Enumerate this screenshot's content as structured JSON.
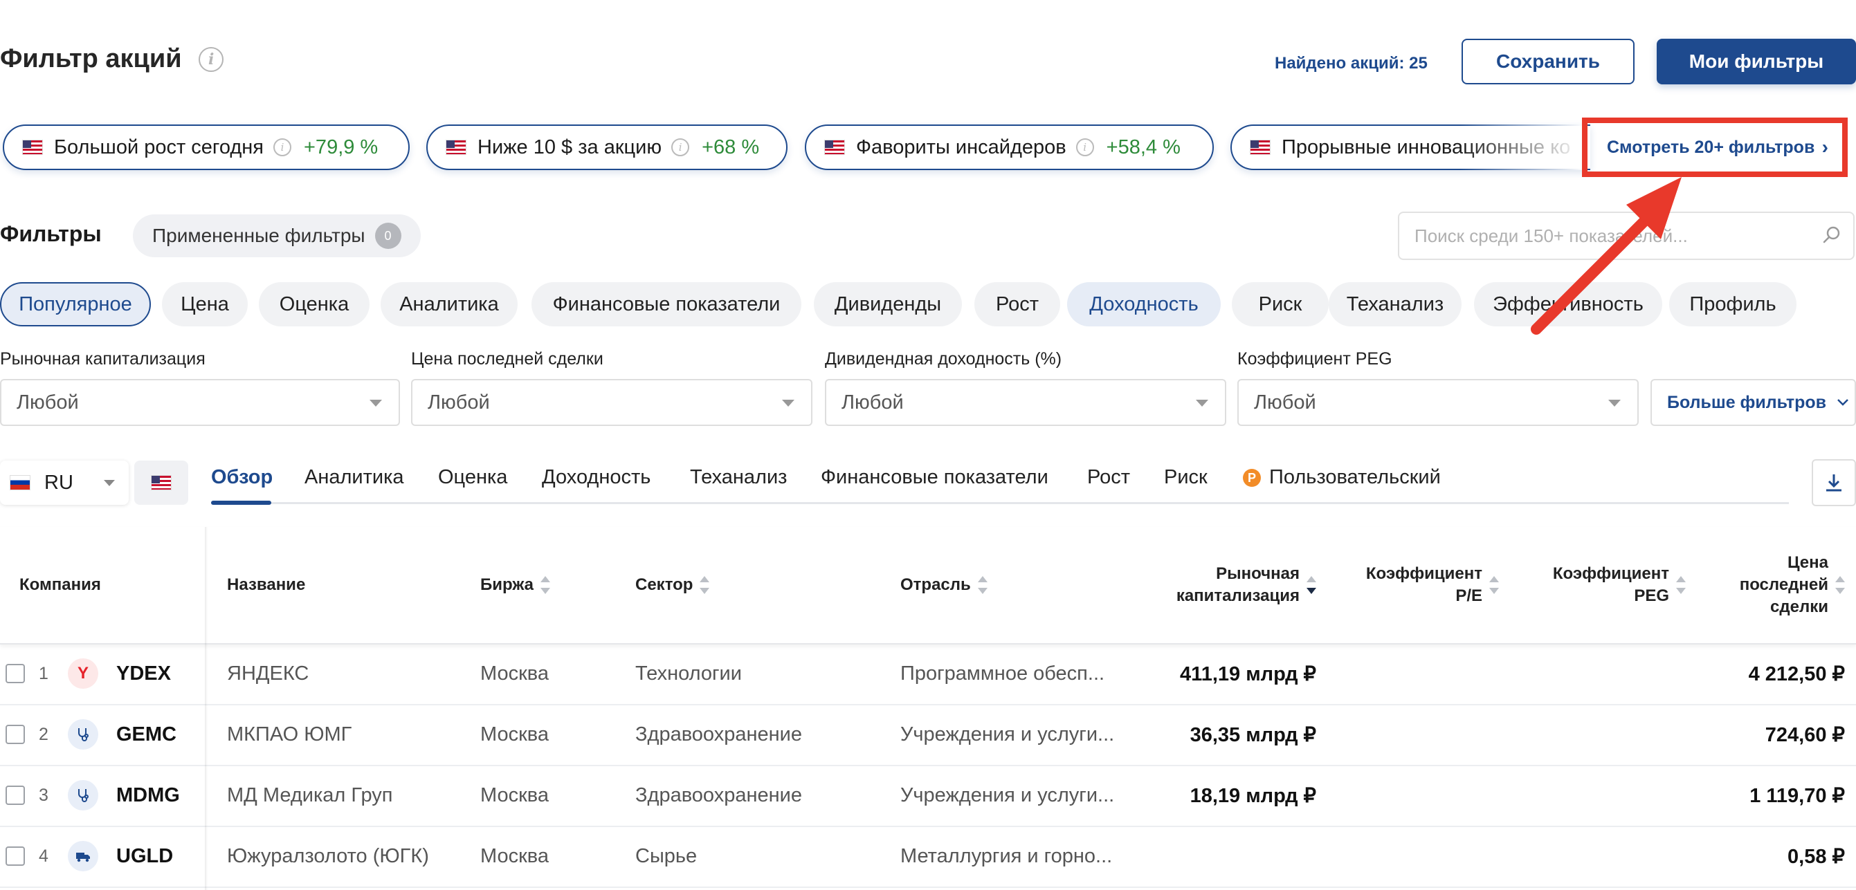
{
  "header": {
    "title": "Фильтр акций",
    "found_label": "Найдено акций: 25",
    "save_label": "Сохранить",
    "my_filters_label": "Мои фильтры"
  },
  "quick_filters": [
    {
      "label": "Большой рост сегодня",
      "change": "+79,9 %"
    },
    {
      "label": "Ниже 10 $ за акцию",
      "change": "+68 %"
    },
    {
      "label": "Фавориты инсайдеров",
      "change": "+58,4 %"
    },
    {
      "label": "Прорывные инновационные ко",
      "change": ""
    }
  ],
  "see_more_filters": "Смотреть 20+ фильтров",
  "filters": {
    "heading": "Фильтры",
    "applied_label": "Примененные фильтры",
    "applied_count": "0",
    "search_placeholder": "Поиск среди 150+ показателей..."
  },
  "categories": [
    "Популярное",
    "Цена",
    "Оценка",
    "Аналитика",
    "Финансовые показатели",
    "Дивиденды",
    "Рост",
    "Доходность",
    "Риск",
    "Теханализ",
    "Эффективность",
    "Профиль"
  ],
  "dropdowns": [
    {
      "label": "Рыночная капитализация",
      "value": "Любой"
    },
    {
      "label": "Цена последней сделки",
      "value": "Любой"
    },
    {
      "label": "Дивидендная доходность (%)",
      "value": "Любой"
    },
    {
      "label": "Коэффициент PEG",
      "value": "Любой"
    }
  ],
  "more_filters_label": "Больше фильтров",
  "country": {
    "code": "RU"
  },
  "tabs": [
    "Обзор",
    "Аналитика",
    "Оценка",
    "Доходность",
    "Теханализ",
    "Финансовые показатели",
    "Рост",
    "Риск",
    "Пользовательский"
  ],
  "table": {
    "headers": {
      "company": "Компания",
      "name": "Название",
      "exchange": "Биржа",
      "sector": "Сектор",
      "industry": "Отрасль",
      "market_cap_1": "Рыночная",
      "market_cap_2": "капитализация",
      "pe_1": "Коэффициент",
      "pe_2": "P/E",
      "peg_1": "Коэффициент",
      "peg_2": "PEG",
      "price_1": "Цена",
      "price_2": "последней",
      "price_3": "сделки"
    },
    "rows": [
      {
        "n": "1",
        "ticker": "YDEX",
        "name": "ЯНДЕКС",
        "exchange": "Москва",
        "sector": "Технологии",
        "industry": "Программное обесп...",
        "cap": "411,19 млрд ₽",
        "pe": "",
        "peg": "",
        "price": "4 212,50 ₽"
      },
      {
        "n": "2",
        "ticker": "GEMC",
        "name": "МКПАО ЮМГ",
        "exchange": "Москва",
        "sector": "Здравоохранение",
        "industry": "Учреждения и услуги...",
        "cap": "36,35 млрд ₽",
        "pe": "",
        "peg": "",
        "price": "724,60 ₽"
      },
      {
        "n": "3",
        "ticker": "MDMG",
        "name": "МД Медикал Груп",
        "exchange": "Москва",
        "sector": "Здравоохранение",
        "industry": "Учреждения и услуги...",
        "cap": "18,19 млрд ₽",
        "pe": "",
        "peg": "",
        "price": "1 119,70 ₽"
      },
      {
        "n": "4",
        "ticker": "UGLD",
        "name": "Южуралзолото (ЮГК)",
        "exchange": "Москва",
        "sector": "Сырье",
        "industry": "Металлургия и горно...",
        "cap": "",
        "pe": "",
        "peg": "",
        "price": "0,58 ₽"
      }
    ]
  },
  "colors": {
    "brand": "#1e4a8e",
    "positive": "#2e8b3a",
    "highlight": "#e8392b"
  }
}
